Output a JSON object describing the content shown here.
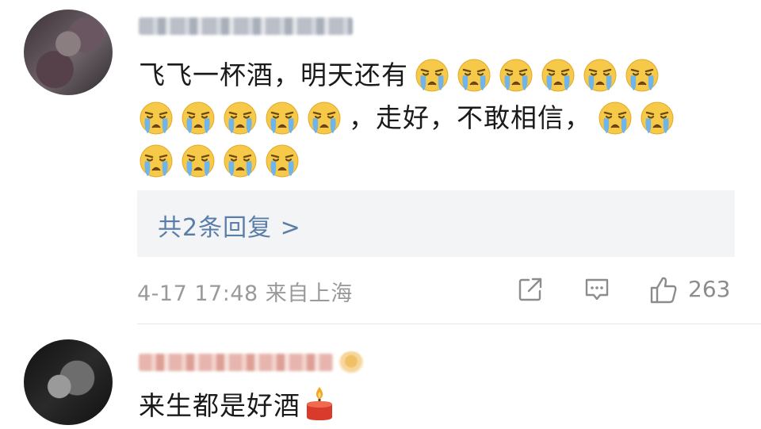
{
  "comments": [
    {
      "text_parts": [
        "飞飞一杯酒，明天还有",
        "，走好，不敢相信，"
      ],
      "emoji_name": "loudly-crying-face",
      "reply_link": "共2条回复 >",
      "meta": "4-17 17:48 来自上海",
      "like_count": "263"
    },
    {
      "text": "来生都是好酒",
      "emoji_name": "candle"
    }
  ],
  "colors": {
    "link": "#5a7ea8",
    "meta": "#9a9a9a",
    "text": "#1a1a1a",
    "reply_bg": "#f3f4f6"
  }
}
